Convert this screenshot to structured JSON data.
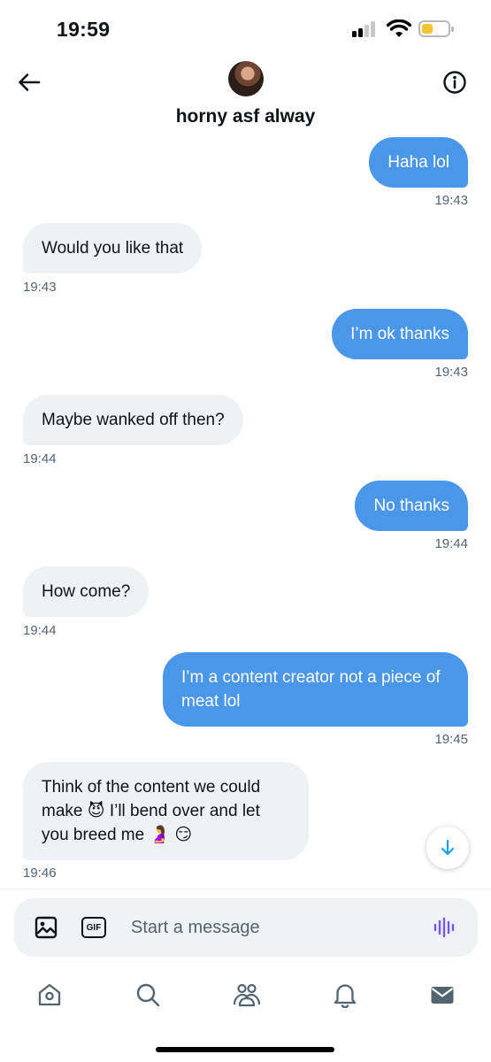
{
  "status_bar": {
    "time": "19:59"
  },
  "header": {
    "title": "horny asf alway"
  },
  "messages": [
    {
      "dir": "out",
      "text": "Haha lol",
      "time": "19:43"
    },
    {
      "dir": "in",
      "text": "Would you like that",
      "time": "19:43"
    },
    {
      "dir": "out",
      "text": "I’m ok thanks",
      "time": "19:43"
    },
    {
      "dir": "in",
      "text": "Maybe wanked off then?",
      "time": "19:44"
    },
    {
      "dir": "out",
      "text": "No thanks",
      "time": "19:44"
    },
    {
      "dir": "in",
      "text": "How come?",
      "time": "19:44"
    },
    {
      "dir": "out",
      "text": "I’m a content creator not a piece of meat lol",
      "time": "19:45"
    },
    {
      "dir": "in",
      "text": "Think of the content we could make 😈 I’ll bend over and let you breed me 🤰 😏",
      "time": "19:46"
    }
  ],
  "composer": {
    "placeholder": "Start a message",
    "gif_label": "GIF"
  },
  "icons": {
    "back": "arrow-left-icon",
    "info": "info-icon",
    "scroll_down": "arrow-down-icon",
    "media": "image-icon",
    "voice": "voice-waveform-icon",
    "tabs": [
      "home-icon",
      "search-icon",
      "communities-icon",
      "bell-icon",
      "mail-icon"
    ]
  },
  "colors": {
    "outgoing_bubble": "#4a96e8",
    "incoming_bubble": "#eff2f4",
    "accent": "#1d9bf0",
    "voice": "#7856ff"
  }
}
